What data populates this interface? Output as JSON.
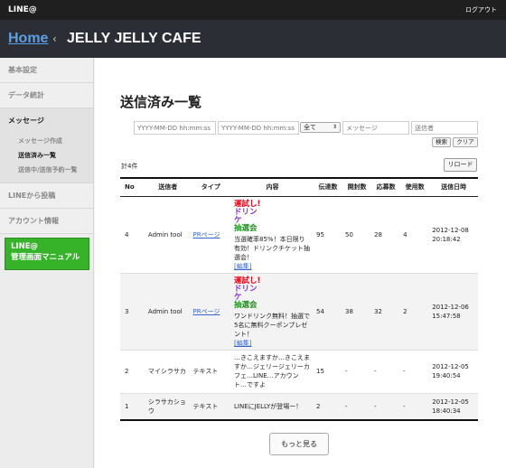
{
  "topbar": {
    "brand": "LINE@",
    "logout": "ログアウト"
  },
  "header": {
    "home": "Home",
    "separator": "‹",
    "account": "JELLY JELLY CAFE"
  },
  "sidebar": {
    "basic": "基本設定",
    "stats": "データ統計",
    "message": "メッセージ",
    "sub": [
      "メッセージ作成",
      "送信済み一覧",
      "送信中/送信予約一覧"
    ],
    "post": "LINEから投稿",
    "account": "アカウント情報",
    "manual_line1": "LINE@",
    "manual_line2": "管理画面マニュアル"
  },
  "main": {
    "title": "送信済み一覧",
    "filter": {
      "from_placeholder": "YYYY-MM-DD hh:mm:ss",
      "to_placeholder": "YYYY-MM-DD hh:mm:ss",
      "select_value": "全て",
      "message_placeholder": "メッセージ",
      "sender_placeholder": "送信者",
      "search": "検索",
      "clear": "クリア"
    },
    "count": "計4件",
    "reload": "リロード",
    "more": "もっと見る"
  },
  "table": {
    "headers": [
      "No",
      "送信者",
      "タイプ",
      "内容",
      "伝達数",
      "開封数",
      "応募数",
      "使用数",
      "送信日時"
    ],
    "rows": [
      {
        "no": "4",
        "sender": "Admin tool",
        "type": "PRページ",
        "banner": [
          "運試し!",
          "ドリンケ",
          "抽選会"
        ],
        "content": "当選確率85%！本日限り有効！ドリンクチケット抽選会！",
        "edit": "[編集]",
        "sent": "95",
        "opened": "50",
        "applied": "28",
        "used": "4",
        "date": "2012-12-08",
        "time": "20:18:42"
      },
      {
        "no": "3",
        "sender": "Admin tool",
        "type": "PRページ",
        "banner": [
          "運試し!",
          "ドリンケ",
          "抽選会"
        ],
        "content": "ワンドリンク無料！抽選で5名に無料クーポンプレゼント！",
        "edit": "[編集]",
        "sent": "54",
        "opened": "38",
        "applied": "32",
        "used": "2",
        "date": "2012-12-06",
        "time": "15:47:58"
      },
      {
        "no": "2",
        "sender": "マイシラサカ",
        "type": "テキスト",
        "content": "…きこえますか…きこえますか…ジェリージェリーカフェ…LINE…アカウント…ですよ",
        "sent": "15",
        "opened": "-",
        "applied": "-",
        "used": "-",
        "date": "2012-12-05",
        "time": "19:40:54"
      },
      {
        "no": "1",
        "sender": "シラサカショウ",
        "type": "テキスト",
        "content": "LINEにJELLYが登場ー！",
        "sent": "2",
        "opened": "-",
        "applied": "-",
        "used": "-",
        "date": "2012-12-05",
        "time": "18:40:34"
      }
    ]
  }
}
